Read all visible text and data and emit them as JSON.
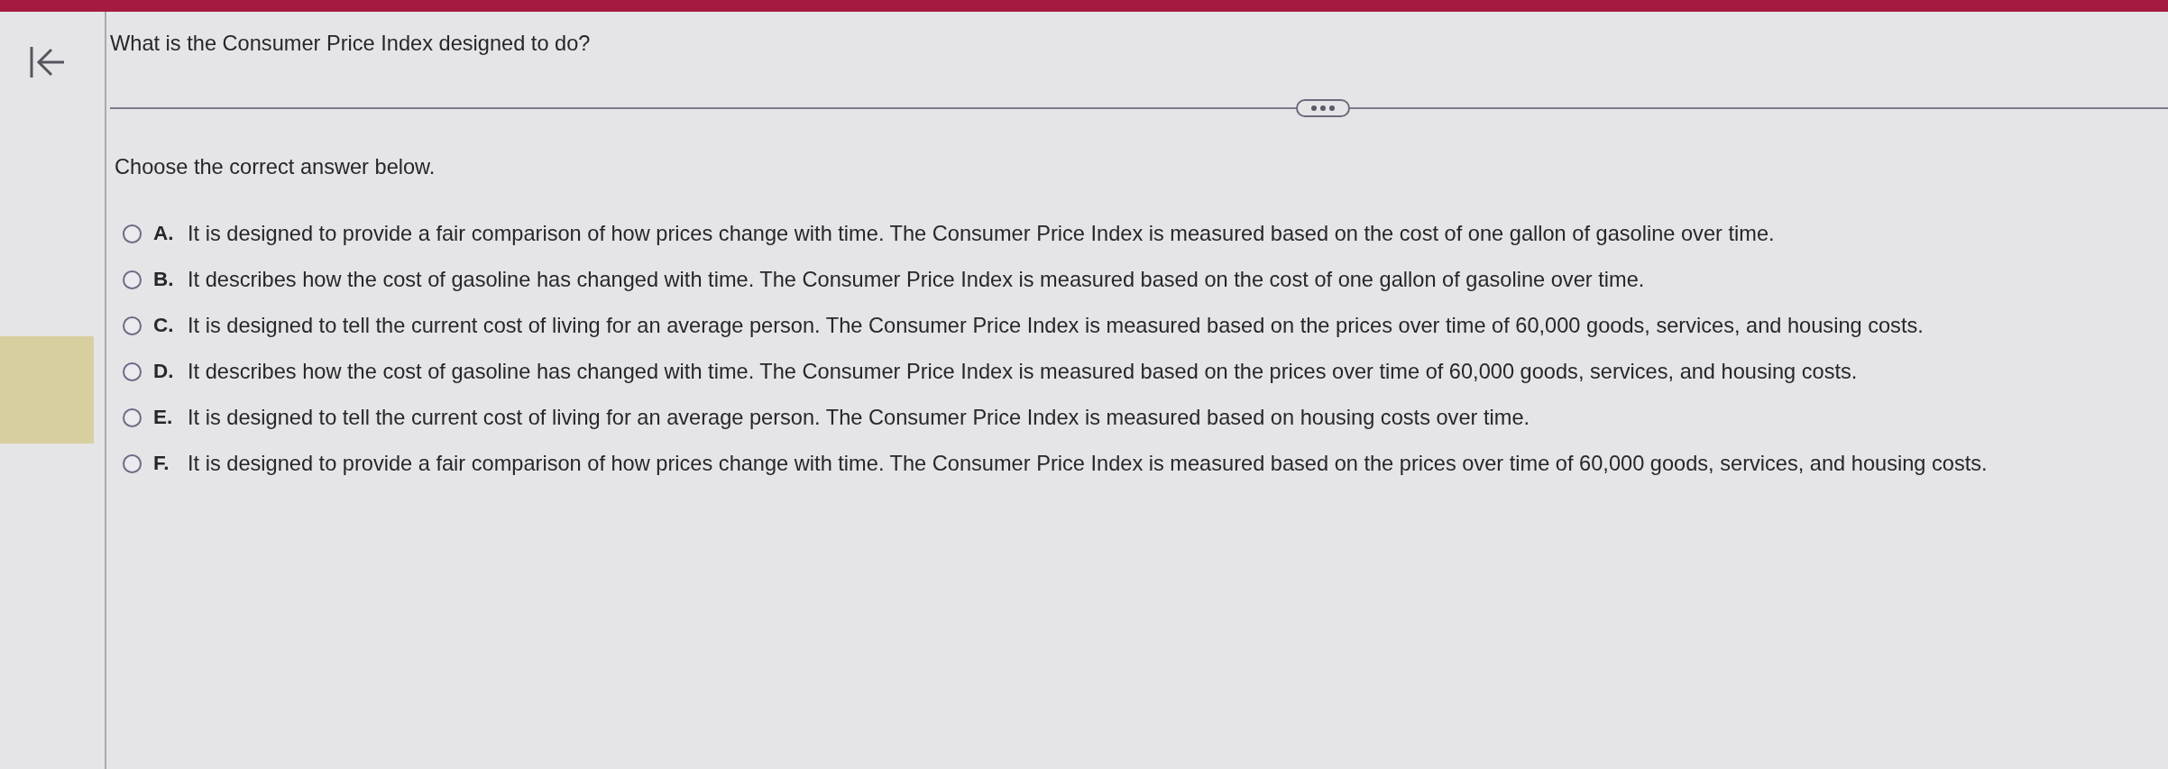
{
  "question": {
    "text": "What is the Consumer Price Index designed to do?"
  },
  "instruction": "Choose the correct answer below.",
  "options": [
    {
      "letter": "A.",
      "text": "It is designed to provide a fair comparison of how prices change with time. The Consumer Price Index is measured based on the cost of one gallon of gasoline over time.",
      "selected": false
    },
    {
      "letter": "B.",
      "text": "It describes how the cost of gasoline has changed with time. The Consumer Price Index is measured based on the cost of one gallon of gasoline over time.",
      "selected": false
    },
    {
      "letter": "C.",
      "text": "It is designed to tell the current cost of living for an average person. The Consumer Price Index is measured based on the prices over time of 60,000 goods, services, and housing costs.",
      "selected": false
    },
    {
      "letter": "D.",
      "text": "It describes how the cost of gasoline has changed with time. The Consumer Price Index is measured based on the prices over time of 60,000 goods, services, and housing costs.",
      "selected": false
    },
    {
      "letter": "E.",
      "text": "It is designed to tell the current cost of living for an average person. The Consumer Price Index is measured based on housing costs over time.",
      "selected": false
    },
    {
      "letter": "F.",
      "text": "It is designed to provide a fair comparison of how prices change with time. The Consumer Price Index is measured based on the prices over time of 60,000 goods, services, and housing costs.",
      "selected": false
    }
  ]
}
